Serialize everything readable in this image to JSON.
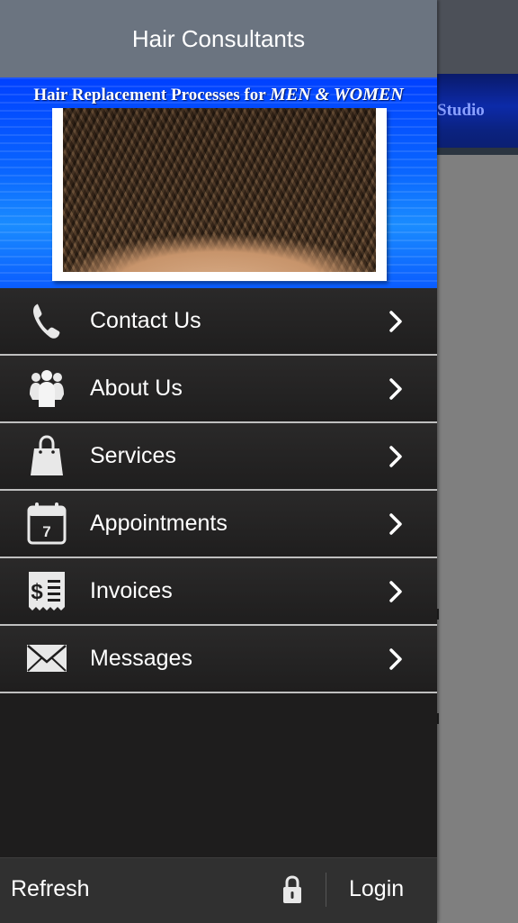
{
  "background": {
    "banner_text": "Studio"
  },
  "drawer": {
    "title": "Hair Consultants",
    "banner": {
      "title_plain": "Hair Replacement Processes for ",
      "title_emphasis": "MEN & WOMEN"
    },
    "menu": [
      {
        "label": "Contact Us",
        "icon": "phone-icon"
      },
      {
        "label": "About Us",
        "icon": "people-icon"
      },
      {
        "label": "Services",
        "icon": "shopping-bag-icon"
      },
      {
        "label": "Appointments",
        "icon": "calendar-icon",
        "icon_text": "7"
      },
      {
        "label": "Invoices",
        "icon": "invoice-icon",
        "icon_text": "$"
      },
      {
        "label": "Messages",
        "icon": "envelope-icon"
      }
    ],
    "footer": {
      "refresh_label": "Refresh",
      "login_label": "Login",
      "lock_icon": "lock-icon"
    }
  },
  "colors": {
    "header_bg": "#6b7480",
    "drawer_bg": "#1e1d1d",
    "banner_blue": "#0a66ff",
    "text": "#ffffff"
  }
}
